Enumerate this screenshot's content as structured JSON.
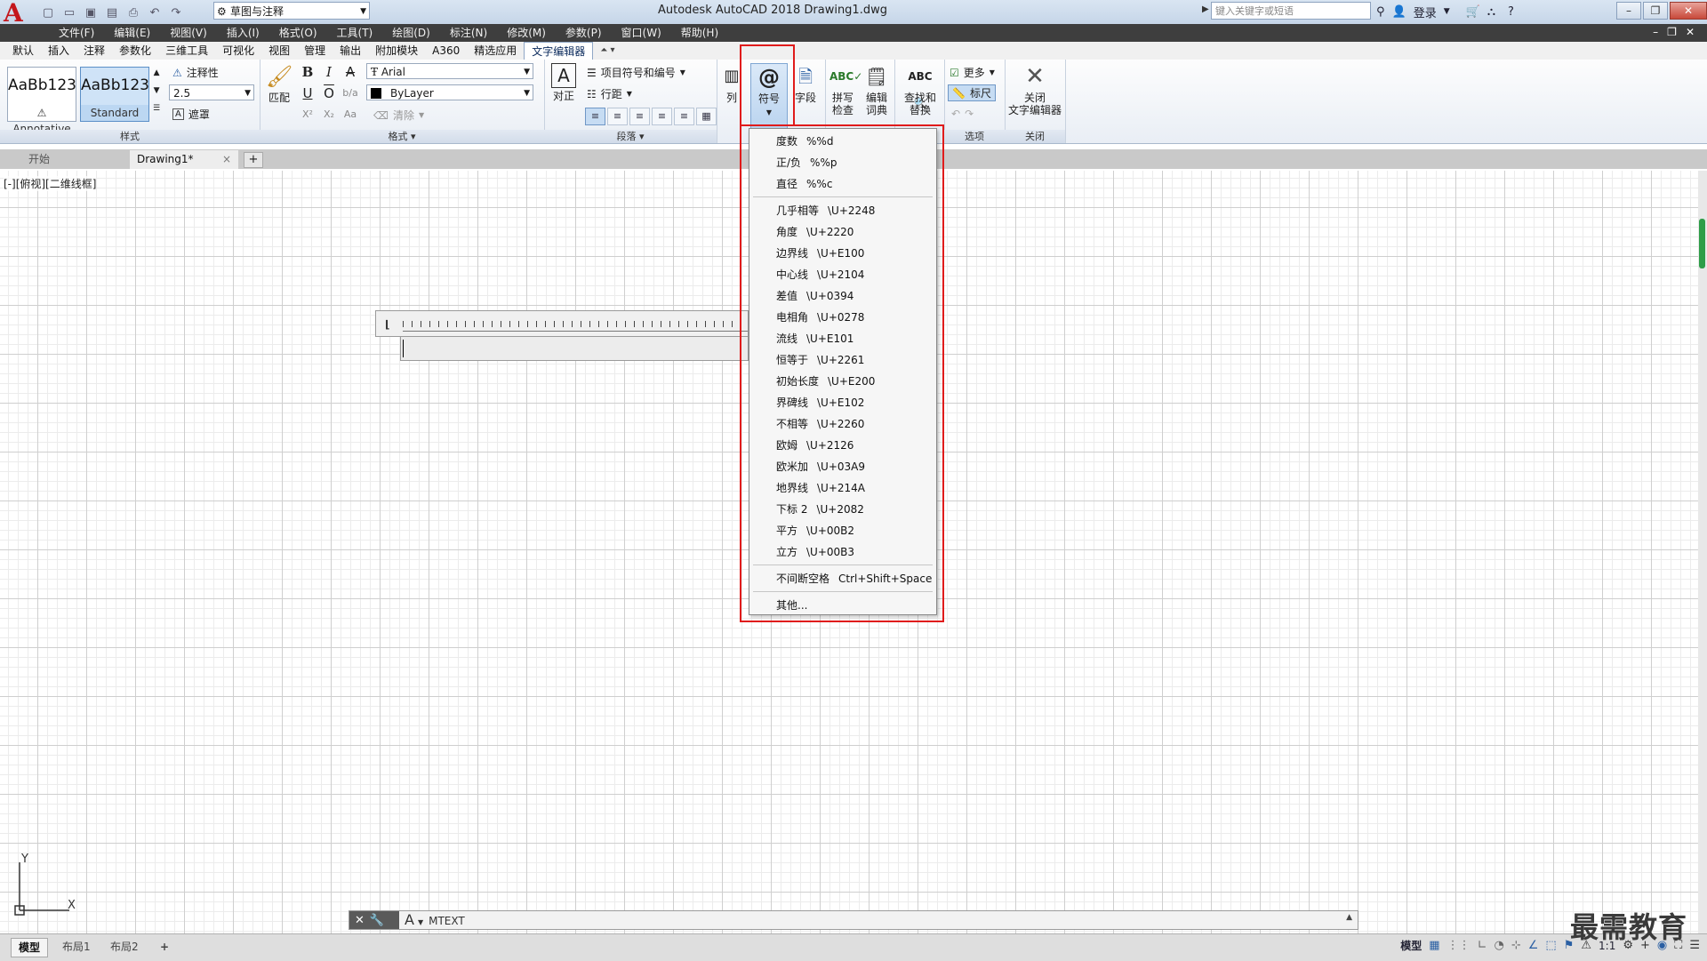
{
  "app": {
    "logo": "A",
    "title": "Autodesk AutoCAD 2018    Drawing1.dwg",
    "workspace": "草图与注释",
    "search_placeholder": "键入关键字或短语",
    "login": "登录"
  },
  "quick_access": [
    "new-icon",
    "open-icon",
    "save-icon",
    "saveas-icon",
    "print-icon",
    "undo-icon",
    "redo-icon"
  ],
  "menubar": [
    "文件(F)",
    "编辑(E)",
    "视图(V)",
    "插入(I)",
    "格式(O)",
    "工具(T)",
    "绘图(D)",
    "标注(N)",
    "修改(M)",
    "参数(P)",
    "窗口(W)",
    "帮助(H)"
  ],
  "ribbon_tabs": [
    "默认",
    "插入",
    "注释",
    "参数化",
    "三维工具",
    "可视化",
    "视图",
    "管理",
    "输出",
    "附加模块",
    "A360",
    "精选应用",
    "文字编辑器"
  ],
  "ribbon_active_tab": "文字编辑器",
  "ribbon": {
    "style": {
      "tile1_big": "AaBb123",
      "tile1_sub": "Annotative",
      "tile2_big": "AaBb123",
      "tile2_sub": "Standard",
      "annotative": "注释性",
      "height": "2.5",
      "mask": "遮罩",
      "title": "样式"
    },
    "format": {
      "match": "匹配",
      "font": "Arial",
      "color": "ByLayer",
      "clear": "清除",
      "title": "格式 ▾"
    },
    "paragraph": {
      "justify": "对正",
      "bullets": "项目符号和编号",
      "line_spacing": "行距",
      "title": "段落"
    },
    "insert": {
      "columns": "列",
      "symbol": "符号",
      "field": "字段"
    },
    "spell": {
      "spell_line1": "拼写",
      "spell_line2": "检查",
      "dict_line1": "编辑",
      "dict_line2": "词典"
    },
    "tools": {
      "find_line1": "查找和",
      "find_line2": "替换"
    },
    "options": {
      "more": "更多",
      "ruler": "标尺",
      "title": "选项"
    },
    "close": {
      "label_line1": "关闭",
      "label_line2": "文字编辑器",
      "title": "关闭"
    }
  },
  "file_tabs": {
    "start": "开始",
    "drawing": "Drawing1*",
    "close": "×",
    "add": "+"
  },
  "viewport_label": "[-][俯视][二维线框]",
  "symbol_menu": {
    "group1": [
      {
        "name": "度数",
        "code": "%%d"
      },
      {
        "name": "正/负",
        "code": "%%p"
      },
      {
        "name": "直径",
        "code": "%%c"
      }
    ],
    "group2": [
      {
        "name": "几乎相等",
        "code": "\\U+2248"
      },
      {
        "name": "角度",
        "code": "\\U+2220"
      },
      {
        "name": "边界线",
        "code": "\\U+E100"
      },
      {
        "name": "中心线",
        "code": "\\U+2104"
      },
      {
        "name": "差值",
        "code": "\\U+0394"
      },
      {
        "name": "电相角",
        "code": "\\U+0278"
      },
      {
        "name": "流线",
        "code": "\\U+E101"
      },
      {
        "name": "恒等于",
        "code": "\\U+2261"
      },
      {
        "name": "初始长度",
        "code": "\\U+E200"
      },
      {
        "name": "界碑线",
        "code": "\\U+E102"
      },
      {
        "name": "不相等",
        "code": "\\U+2260"
      },
      {
        "name": "欧姆",
        "code": "\\U+2126"
      },
      {
        "name": "欧米加",
        "code": "\\U+03A9"
      },
      {
        "name": "地界线",
        "code": "\\U+214A"
      },
      {
        "name": "下标 2",
        "code": "\\U+2082"
      },
      {
        "name": "平方",
        "code": "\\U+00B2"
      },
      {
        "name": "立方",
        "code": "\\U+00B3"
      }
    ],
    "group3": [
      {
        "name": "不间断空格",
        "code": "Ctrl+Shift+Space"
      }
    ],
    "other": "其他..."
  },
  "command_line": {
    "prompt": "MTEXT"
  },
  "status": {
    "layouts": [
      "模型",
      "布局1",
      "布局2"
    ],
    "add_layout": "+",
    "model": "模型",
    "scale": "1:1"
  },
  "ucs": {
    "x": "X",
    "y": "Y"
  },
  "watermark": "最需教育",
  "colors": {
    "highlight_red": "#e01b1b",
    "menubar": "#3e3e3e",
    "accent": "#2a5fa3"
  }
}
